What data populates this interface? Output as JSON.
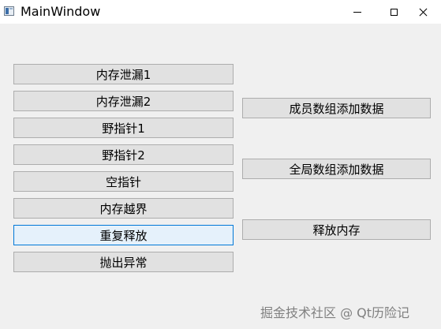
{
  "window": {
    "title": "MainWindow"
  },
  "left_buttons": [
    {
      "label": "内存泄漏1"
    },
    {
      "label": "内存泄漏2"
    },
    {
      "label": "野指针1"
    },
    {
      "label": "野指针2"
    },
    {
      "label": "空指针"
    },
    {
      "label": "内存越界"
    },
    {
      "label": "重复释放"
    },
    {
      "label": "抛出异常"
    }
  ],
  "right_buttons": [
    {
      "label": "成员数组添加数据"
    },
    {
      "label": "全局数组添加数据"
    },
    {
      "label": "释放内存"
    }
  ],
  "watermark": "掘金技术社区 @ Qt历险记",
  "colors": {
    "background": "#f0f0f0",
    "button": "#e1e1e1",
    "button_border": "#adadad",
    "focused_button": "#e5f1fb",
    "focus_border": "#0078d7"
  }
}
